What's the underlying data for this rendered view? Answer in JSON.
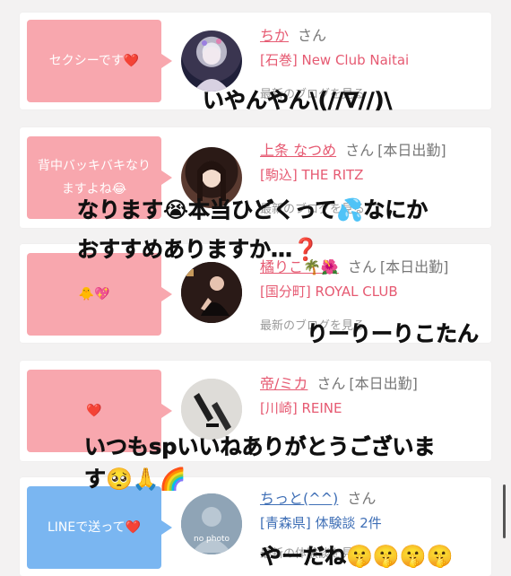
{
  "cards": [
    {
      "bubble": "セクシーです❤️",
      "name": "ちか",
      "honorific": "さん",
      "status": "",
      "store": "[石巻] New Club Naitai",
      "blog": "最新のブログを見る"
    },
    {
      "bubble": "背中バッキバキなりますよね😂",
      "name": "上条 なつめ",
      "honorific": "さん",
      "status": "[本日出勤]",
      "store": "[駒込] THE RITZ",
      "blog": "最新のブログを見る"
    },
    {
      "bubble": "🐥💖",
      "name": "橘りこ🌴🌺",
      "honorific": "さん",
      "status": "[本日出勤]",
      "store": "[国分町] ROYAL CLUB",
      "blog": "最新のブログを見る"
    },
    {
      "bubble": "❤️",
      "name": "帝/ミカ",
      "honorific": "さん",
      "status": "[本日出勤]",
      "store": "[川崎] REINE",
      "blog": "最新のブログを見る"
    },
    {
      "bubble": "LINEで送って❤️",
      "name": "ちっと(^^)",
      "honorific": "さん",
      "status": "",
      "store": "[青森県] 体験談 2件",
      "blog": "最新の体験談を見る",
      "avatar_label": "no photo"
    }
  ],
  "overlays": {
    "line1": "いやんやん\\(//∇//)\\",
    "line2": "なります😭本当ひどくって💦なにか",
    "line3": "おすすめありますか…❓",
    "line4": "りーりーりこたん",
    "line5": "いつもspいいねありがとうございま",
    "line6": "す🥺🙏🌈",
    "line7": "やーだね🤫🤫🤫🤫"
  },
  "colors": {
    "bubble_pink": "#f8a7ae",
    "bubble_blue": "#7ab6f1",
    "name_pink": "#e65a72",
    "name_blue": "#3f6fb6"
  }
}
